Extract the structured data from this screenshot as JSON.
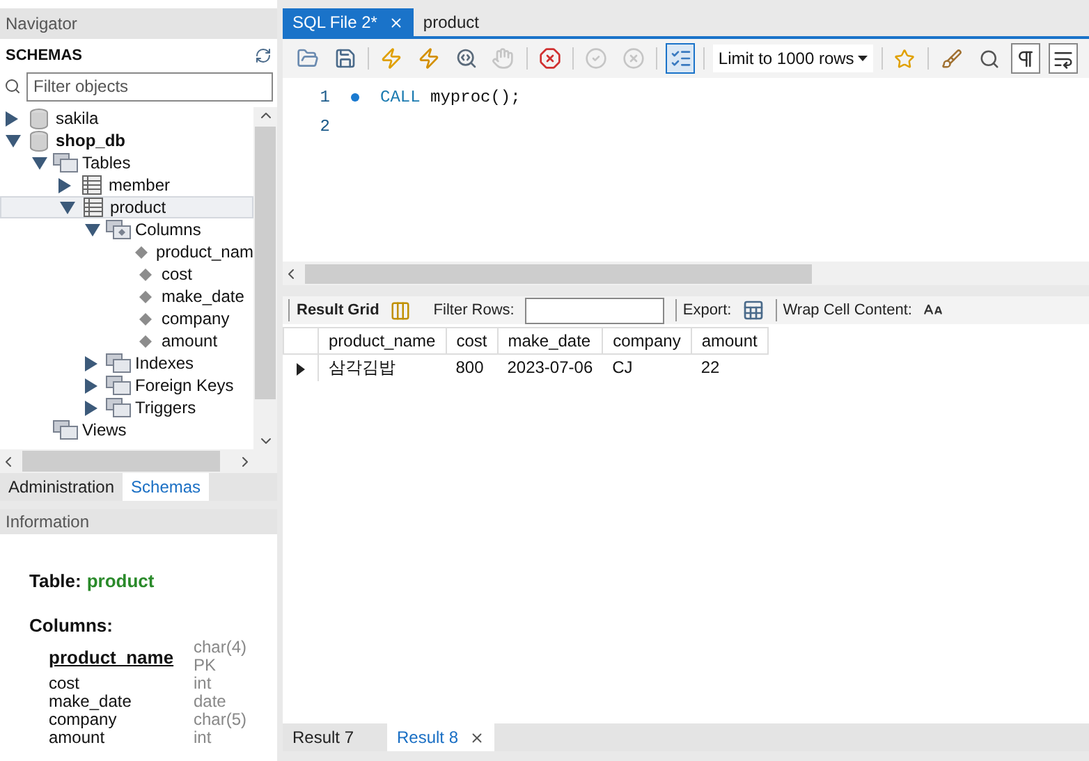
{
  "navigator": {
    "title": "Navigator",
    "schemas_label": "SCHEMAS",
    "filter": {
      "placeholder": "Filter objects"
    },
    "tree": [
      {
        "label": "sakila",
        "kind": "database",
        "bold": false,
        "expanded": false,
        "selected": false
      },
      {
        "label": "shop_db",
        "kind": "database",
        "bold": true,
        "expanded": true,
        "selected": false,
        "children": [
          {
            "label": "Tables",
            "kind": "folder",
            "expanded": true,
            "selected": false,
            "children": [
              {
                "label": "member",
                "kind": "table",
                "expanded": false,
                "selected": false
              },
              {
                "label": "product",
                "kind": "table",
                "expanded": true,
                "selected": true,
                "children": [
                  {
                    "label": "Columns",
                    "kind": "columns",
                    "expanded": true,
                    "selected": false,
                    "children": [
                      {
                        "label": "product_nam",
                        "kind": "column",
                        "selected": false
                      },
                      {
                        "label": "cost",
                        "kind": "column",
                        "selected": false
                      },
                      {
                        "label": "make_date",
                        "kind": "column",
                        "selected": false
                      },
                      {
                        "label": "company",
                        "kind": "column",
                        "selected": false
                      },
                      {
                        "label": "amount",
                        "kind": "column",
                        "selected": false
                      }
                    ]
                  },
                  {
                    "label": "Indexes",
                    "kind": "folder",
                    "expanded": false,
                    "selected": false
                  },
                  {
                    "label": "Foreign Keys",
                    "kind": "folder",
                    "expanded": false,
                    "selected": false
                  },
                  {
                    "label": "Triggers",
                    "kind": "folder",
                    "expanded": false,
                    "selected": false
                  }
                ]
              }
            ]
          },
          {
            "label": "Views",
            "kind": "folder",
            "selected": false
          }
        ]
      }
    ]
  },
  "panel_tabs": [
    {
      "label": "Administration",
      "selected": false
    },
    {
      "label": "Schemas",
      "selected": true
    }
  ],
  "information": {
    "title": "Information",
    "table_label": "Table:",
    "table_name": "product",
    "columns_label": "Columns:",
    "columns": [
      {
        "name": "product_name",
        "type": "char(4)",
        "key": "PK",
        "primary": true
      },
      {
        "name": "cost",
        "type": "int",
        "primary": false
      },
      {
        "name": "make_date",
        "type": "date",
        "primary": false
      },
      {
        "name": "company",
        "type": "char(5)",
        "primary": false
      },
      {
        "name": "amount",
        "type": "int",
        "primary": false
      }
    ]
  },
  "editor_tabs": [
    {
      "label": "SQL File 2*",
      "selected": true
    },
    {
      "label": "product",
      "selected": false
    }
  ],
  "toolbar": {
    "buttons": [
      {
        "disabled": false,
        "on": false
      },
      {
        "disabled": false,
        "on": false
      },
      {
        "disabled": false,
        "on": false
      },
      {
        "disabled": false,
        "on": false
      },
      {
        "disabled": false,
        "on": false
      },
      {
        "disabled": true,
        "on": false
      },
      {
        "disabled": false,
        "on": false
      },
      {
        "disabled": true,
        "on": false
      },
      {
        "disabled": true,
        "on": false
      },
      {
        "disabled": false,
        "on": true
      }
    ],
    "limit": "Limit to 1000 rows",
    "tools": [
      {
        "disabled": false
      },
      {
        "disabled": false
      },
      {
        "disabled": false
      },
      {
        "disabled": false
      },
      {
        "disabled": false
      }
    ]
  },
  "editor_lines": [
    {
      "number": "1",
      "marker": true,
      "keyword": "CALL",
      "code": " myproc();"
    },
    {
      "number": "2",
      "marker": false
    }
  ],
  "result_toolbar": {
    "result_grid": "Result Grid",
    "filter_label": "Filter Rows:",
    "export_label": "Export:",
    "wrap_label": "Wrap Cell Content:"
  },
  "grid": {
    "columns": [
      "product_name",
      "cost",
      "make_date",
      "company",
      "amount"
    ],
    "rows": [
      {
        "current": true,
        "cells": [
          "삼각김밥",
          "800",
          "2023-07-06",
          "CJ",
          "22"
        ]
      }
    ]
  },
  "result_tabs": [
    {
      "label": "Result 7",
      "selected": false
    },
    {
      "label": "Result 8",
      "selected": true
    }
  ]
}
